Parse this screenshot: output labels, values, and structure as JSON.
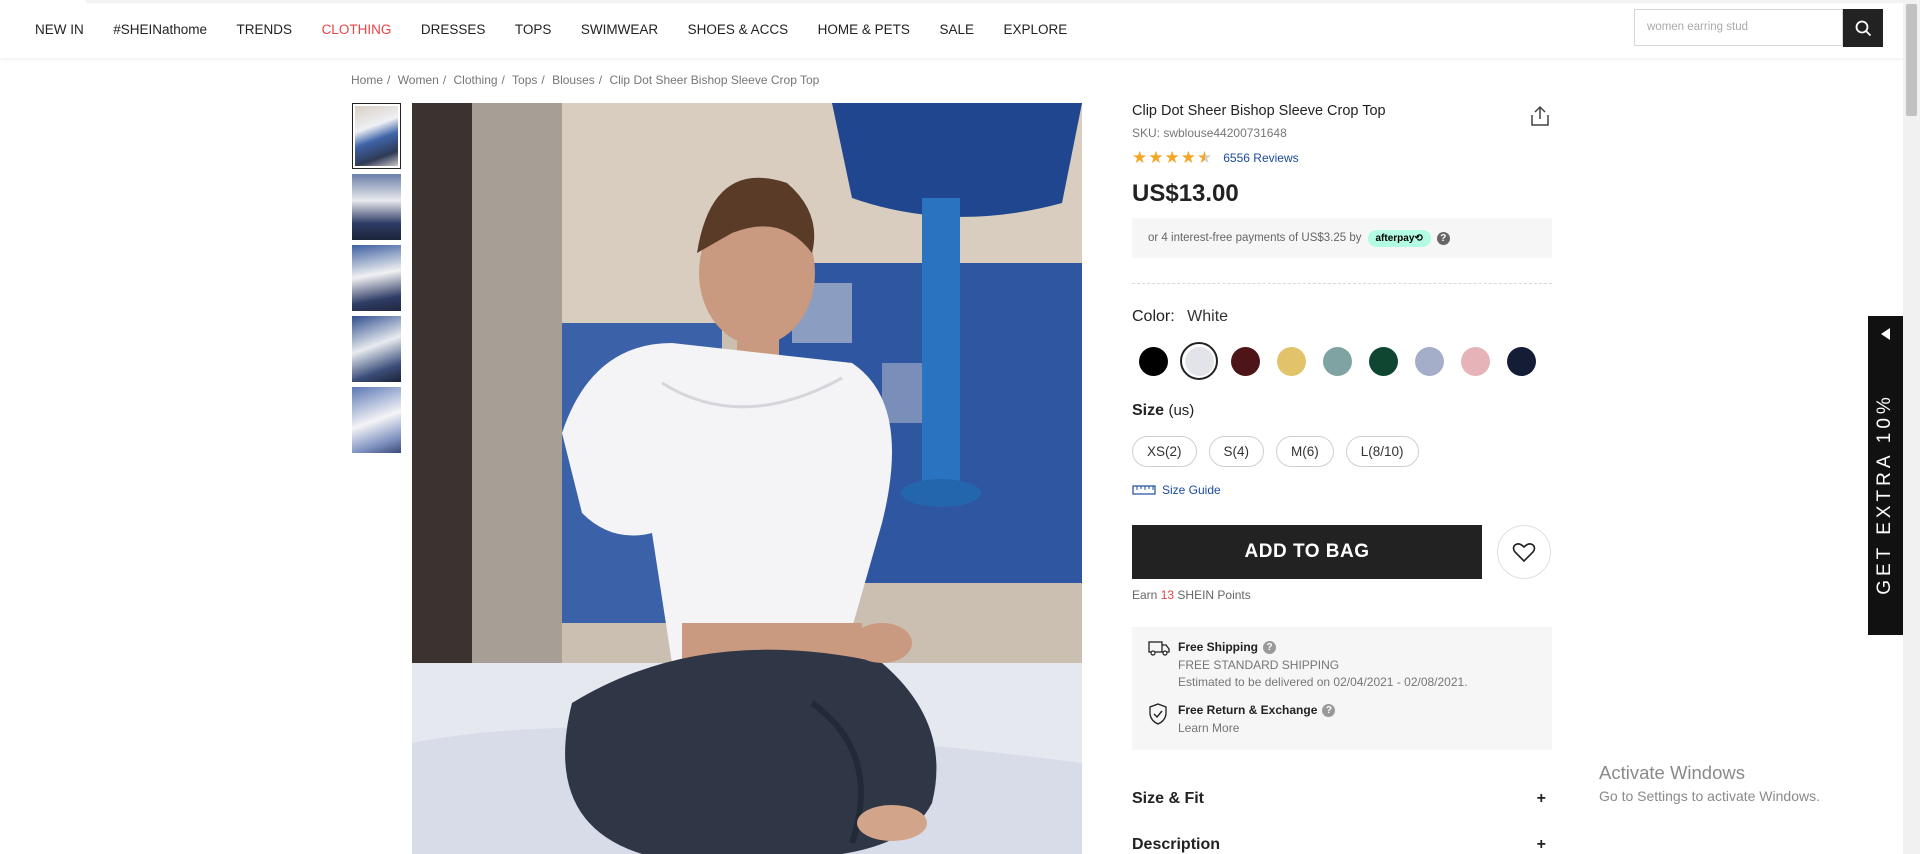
{
  "nav": {
    "items": [
      {
        "label": "NEW IN"
      },
      {
        "label": "#SHEINathome"
      },
      {
        "label": "TRENDS"
      },
      {
        "label": "CLOTHING",
        "active": true
      },
      {
        "label": "DRESSES"
      },
      {
        "label": "TOPS"
      },
      {
        "label": "SWIMWEAR"
      },
      {
        "label": "SHOES & ACCS"
      },
      {
        "label": "HOME & PETS"
      },
      {
        "label": "SALE"
      },
      {
        "label": "EXPLORE"
      }
    ],
    "active_color": "#e64545",
    "search": {
      "placeholder": "women earring stud",
      "icon": "search-icon"
    }
  },
  "breadcrumb": [
    "Home",
    "Women",
    "Clothing",
    "Tops",
    "Blouses",
    "Clip Dot Sheer Bishop Sleeve Crop Top"
  ],
  "thumbnails": [
    {
      "selected": true
    },
    {
      "selected": false
    },
    {
      "selected": false
    },
    {
      "selected": false
    },
    {
      "selected": false
    }
  ],
  "product": {
    "title": "Clip Dot Sheer Bishop Sleeve Crop Top",
    "sku": "SKU: swblouse44200731648",
    "rating": 4.5,
    "reviews": "6556 Reviews",
    "price": "US$13.00",
    "afterpay": {
      "text": "or 4 interest-free payments of US$3.25 by",
      "badge": "afterpay",
      "help": "?"
    },
    "color": {
      "label": "Color:",
      "value": "White",
      "swatches": [
        {
          "hex": "#000000",
          "selected": false
        },
        {
          "hex": "#e3e4ea",
          "selected": true
        },
        {
          "hex": "#4e1518",
          "selected": false
        },
        {
          "hex": "#e2c36a",
          "selected": false
        },
        {
          "hex": "#7fa3a3",
          "selected": false
        },
        {
          "hex": "#0f4632",
          "selected": false
        },
        {
          "hex": "#a4aec8",
          "selected": false
        },
        {
          "hex": "#e6b4b8",
          "selected": false
        },
        {
          "hex": "#151c36",
          "selected": false
        }
      ]
    },
    "size": {
      "label": "Size",
      "unit": "(us)",
      "options": [
        "XS(2)",
        "S(4)",
        "M(6)",
        "L(8/10)"
      ],
      "guide": "Size Guide"
    },
    "add_to_bag": "ADD TO BAG",
    "points": {
      "prefix": "Earn",
      "value": "13",
      "suffix": "SHEIN Points"
    }
  },
  "shipping": {
    "free_shipping": {
      "title": "Free Shipping",
      "line1": "FREE STANDARD SHIPPING",
      "line2": "Estimated to be delivered on 02/04/2021 - 02/08/2021."
    },
    "returns": {
      "title": "Free Return & Exchange",
      "link": "Learn More"
    }
  },
  "accordions": [
    {
      "label": "Size & Fit",
      "icon": "+"
    },
    {
      "label": "Description",
      "icon": "+"
    }
  ],
  "windows_watermark": {
    "line1": "Activate Windows",
    "line2": "Go to Settings to activate Windows."
  },
  "promo_tab": {
    "text": "GET EXTRA 10%"
  }
}
